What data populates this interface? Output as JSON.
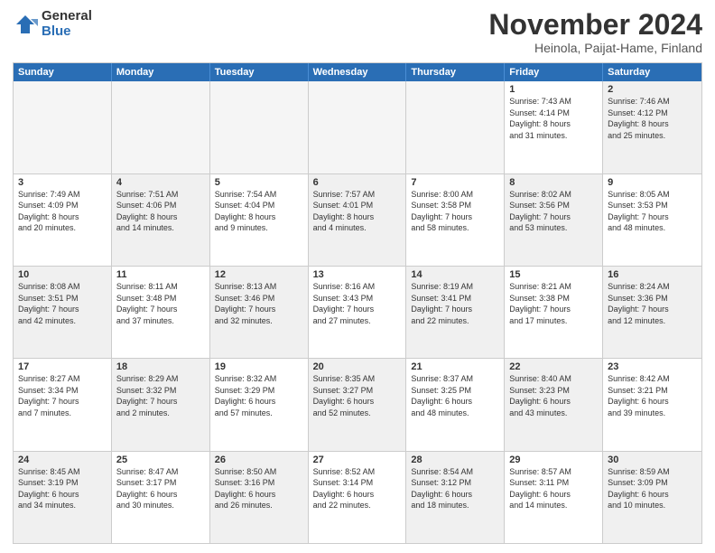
{
  "logo": {
    "general": "General",
    "blue": "Blue"
  },
  "header": {
    "month": "November 2024",
    "location": "Heinola, Paijat-Hame, Finland"
  },
  "weekdays": [
    "Sunday",
    "Monday",
    "Tuesday",
    "Wednesday",
    "Thursday",
    "Friday",
    "Saturday"
  ],
  "rows": [
    {
      "cells": [
        {
          "empty": true
        },
        {
          "empty": true
        },
        {
          "empty": true
        },
        {
          "empty": true
        },
        {
          "empty": true
        },
        {
          "day": "1",
          "lines": [
            "Sunrise: 7:43 AM",
            "Sunset: 4:14 PM",
            "Daylight: 8 hours",
            "and 31 minutes."
          ]
        },
        {
          "day": "2",
          "shaded": true,
          "lines": [
            "Sunrise: 7:46 AM",
            "Sunset: 4:12 PM",
            "Daylight: 8 hours",
            "and 25 minutes."
          ]
        }
      ]
    },
    {
      "cells": [
        {
          "day": "3",
          "lines": [
            "Sunrise: 7:49 AM",
            "Sunset: 4:09 PM",
            "Daylight: 8 hours",
            "and 20 minutes."
          ]
        },
        {
          "day": "4",
          "shaded": true,
          "lines": [
            "Sunrise: 7:51 AM",
            "Sunset: 4:06 PM",
            "Daylight: 8 hours",
            "and 14 minutes."
          ]
        },
        {
          "day": "5",
          "lines": [
            "Sunrise: 7:54 AM",
            "Sunset: 4:04 PM",
            "Daylight: 8 hours",
            "and 9 minutes."
          ]
        },
        {
          "day": "6",
          "shaded": true,
          "lines": [
            "Sunrise: 7:57 AM",
            "Sunset: 4:01 PM",
            "Daylight: 8 hours",
            "and 4 minutes."
          ]
        },
        {
          "day": "7",
          "lines": [
            "Sunrise: 8:00 AM",
            "Sunset: 3:58 PM",
            "Daylight: 7 hours",
            "and 58 minutes."
          ]
        },
        {
          "day": "8",
          "shaded": true,
          "lines": [
            "Sunrise: 8:02 AM",
            "Sunset: 3:56 PM",
            "Daylight: 7 hours",
            "and 53 minutes."
          ]
        },
        {
          "day": "9",
          "lines": [
            "Sunrise: 8:05 AM",
            "Sunset: 3:53 PM",
            "Daylight: 7 hours",
            "and 48 minutes."
          ]
        }
      ]
    },
    {
      "cells": [
        {
          "day": "10",
          "shaded": true,
          "lines": [
            "Sunrise: 8:08 AM",
            "Sunset: 3:51 PM",
            "Daylight: 7 hours",
            "and 42 minutes."
          ]
        },
        {
          "day": "11",
          "lines": [
            "Sunrise: 8:11 AM",
            "Sunset: 3:48 PM",
            "Daylight: 7 hours",
            "and 37 minutes."
          ]
        },
        {
          "day": "12",
          "shaded": true,
          "lines": [
            "Sunrise: 8:13 AM",
            "Sunset: 3:46 PM",
            "Daylight: 7 hours",
            "and 32 minutes."
          ]
        },
        {
          "day": "13",
          "lines": [
            "Sunrise: 8:16 AM",
            "Sunset: 3:43 PM",
            "Daylight: 7 hours",
            "and 27 minutes."
          ]
        },
        {
          "day": "14",
          "shaded": true,
          "lines": [
            "Sunrise: 8:19 AM",
            "Sunset: 3:41 PM",
            "Daylight: 7 hours",
            "and 22 minutes."
          ]
        },
        {
          "day": "15",
          "lines": [
            "Sunrise: 8:21 AM",
            "Sunset: 3:38 PM",
            "Daylight: 7 hours",
            "and 17 minutes."
          ]
        },
        {
          "day": "16",
          "shaded": true,
          "lines": [
            "Sunrise: 8:24 AM",
            "Sunset: 3:36 PM",
            "Daylight: 7 hours",
            "and 12 minutes."
          ]
        }
      ]
    },
    {
      "cells": [
        {
          "day": "17",
          "lines": [
            "Sunrise: 8:27 AM",
            "Sunset: 3:34 PM",
            "Daylight: 7 hours",
            "and 7 minutes."
          ]
        },
        {
          "day": "18",
          "shaded": true,
          "lines": [
            "Sunrise: 8:29 AM",
            "Sunset: 3:32 PM",
            "Daylight: 7 hours",
            "and 2 minutes."
          ]
        },
        {
          "day": "19",
          "lines": [
            "Sunrise: 8:32 AM",
            "Sunset: 3:29 PM",
            "Daylight: 6 hours",
            "and 57 minutes."
          ]
        },
        {
          "day": "20",
          "shaded": true,
          "lines": [
            "Sunrise: 8:35 AM",
            "Sunset: 3:27 PM",
            "Daylight: 6 hours",
            "and 52 minutes."
          ]
        },
        {
          "day": "21",
          "lines": [
            "Sunrise: 8:37 AM",
            "Sunset: 3:25 PM",
            "Daylight: 6 hours",
            "and 48 minutes."
          ]
        },
        {
          "day": "22",
          "shaded": true,
          "lines": [
            "Sunrise: 8:40 AM",
            "Sunset: 3:23 PM",
            "Daylight: 6 hours",
            "and 43 minutes."
          ]
        },
        {
          "day": "23",
          "lines": [
            "Sunrise: 8:42 AM",
            "Sunset: 3:21 PM",
            "Daylight: 6 hours",
            "and 39 minutes."
          ]
        }
      ]
    },
    {
      "cells": [
        {
          "day": "24",
          "shaded": true,
          "lines": [
            "Sunrise: 8:45 AM",
            "Sunset: 3:19 PM",
            "Daylight: 6 hours",
            "and 34 minutes."
          ]
        },
        {
          "day": "25",
          "lines": [
            "Sunrise: 8:47 AM",
            "Sunset: 3:17 PM",
            "Daylight: 6 hours",
            "and 30 minutes."
          ]
        },
        {
          "day": "26",
          "shaded": true,
          "lines": [
            "Sunrise: 8:50 AM",
            "Sunset: 3:16 PM",
            "Daylight: 6 hours",
            "and 26 minutes."
          ]
        },
        {
          "day": "27",
          "lines": [
            "Sunrise: 8:52 AM",
            "Sunset: 3:14 PM",
            "Daylight: 6 hours",
            "and 22 minutes."
          ]
        },
        {
          "day": "28",
          "shaded": true,
          "lines": [
            "Sunrise: 8:54 AM",
            "Sunset: 3:12 PM",
            "Daylight: 6 hours",
            "and 18 minutes."
          ]
        },
        {
          "day": "29",
          "lines": [
            "Sunrise: 8:57 AM",
            "Sunset: 3:11 PM",
            "Daylight: 6 hours",
            "and 14 minutes."
          ]
        },
        {
          "day": "30",
          "shaded": true,
          "lines": [
            "Sunrise: 8:59 AM",
            "Sunset: 3:09 PM",
            "Daylight: 6 hours",
            "and 10 minutes."
          ]
        }
      ]
    }
  ]
}
